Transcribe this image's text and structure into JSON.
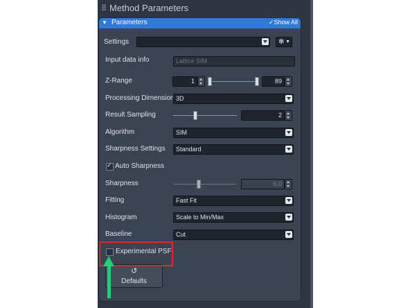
{
  "section": {
    "title": "Method Parameters"
  },
  "panel": {
    "title": "Parameters",
    "show_all": "Show All"
  },
  "settings": {
    "label": "Settings",
    "value": ""
  },
  "input_data_info": {
    "label": "Input data info",
    "placeholder": "Lattice SIM"
  },
  "z_range": {
    "label": "Z-Range",
    "start": "1",
    "end": "89"
  },
  "processing_dimension": {
    "label": "Processing Dimension",
    "value": "3D"
  },
  "result_sampling": {
    "label": "Result Sampling",
    "value": "2"
  },
  "algorithm": {
    "label": "Algorithm",
    "value": "SIM"
  },
  "sharpness_settings": {
    "label": "Sharpness Settings",
    "value": "Standard"
  },
  "auto_sharpness": {
    "label": "Auto Sharpness",
    "checked": true
  },
  "sharpness": {
    "label": "Sharpness",
    "value": "6.0"
  },
  "fitting": {
    "label": "Fitting",
    "value": "Fast Fit"
  },
  "histogram": {
    "label": "Histogram",
    "value": "Scale to Min/Max"
  },
  "baseline": {
    "label": "Baseline",
    "value": "Cut"
  },
  "experimental_psf": {
    "label": "Experimental PSF",
    "checked": false
  },
  "defaults_button": {
    "label": "Defaults"
  },
  "icons": {
    "gear": "gear-icon",
    "reset": "reset-icon",
    "drag": "drag-grip-icon",
    "check": "check-icon",
    "caret": "collapse-caret-icon"
  },
  "colors": {
    "accent": "#2f79d8",
    "highlight": "#e0252b",
    "arrow": "#1fd07a",
    "background": "#2f3542"
  }
}
